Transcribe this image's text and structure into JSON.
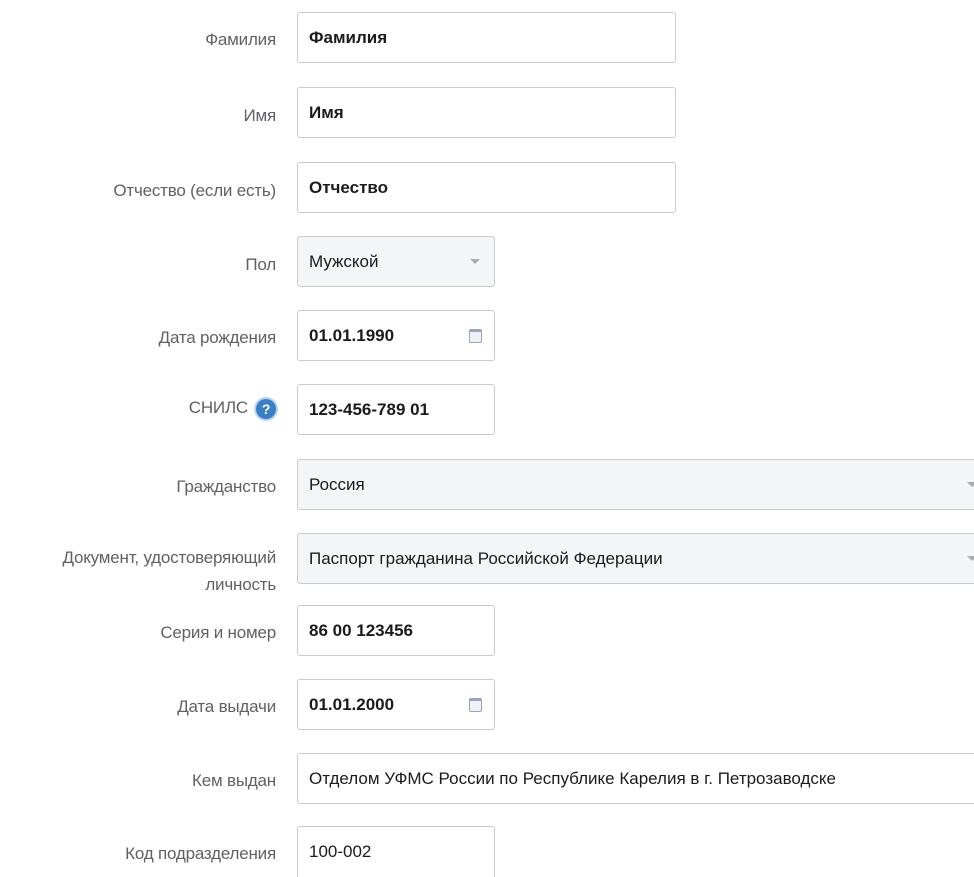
{
  "form": {
    "surname": {
      "label": "Фамилия",
      "value": "Фамилия"
    },
    "name": {
      "label": "Имя",
      "value": "Имя"
    },
    "patronymic": {
      "label": "Отчество (если есть)",
      "value": "Отчество"
    },
    "gender": {
      "label": "Пол",
      "value": "Мужской"
    },
    "birth_date": {
      "label": "Дата рождения",
      "value": "01.01.1990"
    },
    "snils": {
      "label": "СНИЛС",
      "value": "123-456-789 01",
      "help": "?"
    },
    "citizenship": {
      "label": "Гражданство",
      "value": "Россия"
    },
    "id_document": {
      "label_line1": "Документ, удостоверяющий",
      "label_line2": "личность",
      "value": "Паспорт гражданина Российской Федерации"
    },
    "series_number": {
      "label": "Серия и номер",
      "value": "86 00 123456"
    },
    "issue_date": {
      "label": "Дата выдачи",
      "value": "01.01.2000"
    },
    "issued_by": {
      "label": "Кем выдан",
      "value": "Отделом УФМС России по Республике Карелия в г. Петрозаводске"
    },
    "division_code": {
      "label": "Код подразделения",
      "value": "100-002"
    }
  },
  "icons": {
    "dropdown": "chevron-down-icon",
    "calendar": "calendar-icon",
    "help": "question-circle-icon"
  },
  "colors": {
    "label": "#5f6166",
    "border": "#c8cbd0",
    "select_bg": "#f4f5f7",
    "help_blue": "#3a7ec6"
  }
}
